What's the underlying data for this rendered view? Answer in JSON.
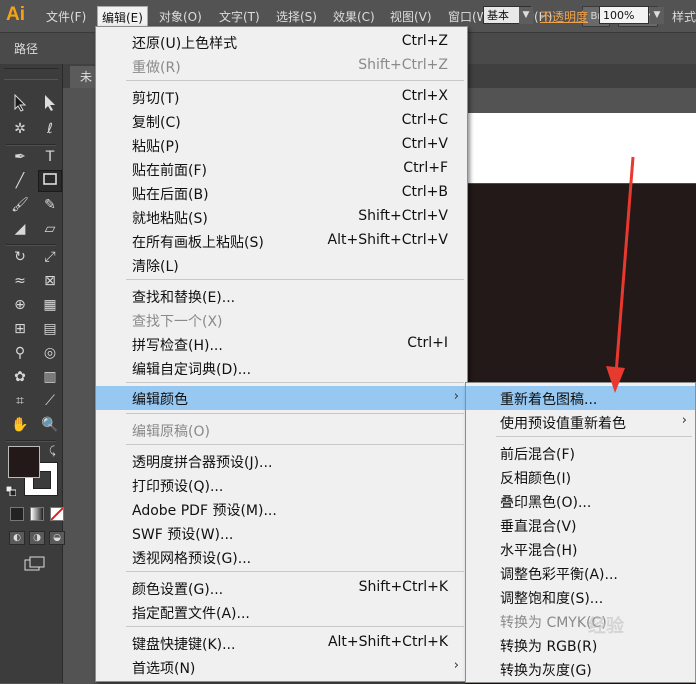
{
  "menubar": {
    "logo": "Ai",
    "items": [
      "文件(F)",
      "编辑(E)",
      "对象(O)",
      "文字(T)",
      "选择(S)",
      "效果(C)",
      "视图(V)",
      "窗口(W)",
      "帮助(H)"
    ],
    "br_label": "Br",
    "workspace_icon": "grid-layout-icon"
  },
  "control": {
    "path_label": "路径",
    "stroke_style": "基本",
    "opacity_label": "不透明度",
    "opacity_value": "100%",
    "style_label": "样式"
  },
  "doc": {
    "tab_label": "未"
  },
  "edit_menu": {
    "items": [
      {
        "label": "还原(U)上色样式",
        "shortcut": "Ctrl+Z"
      },
      {
        "label": "重做(R)",
        "shortcut": "Shift+Ctrl+Z",
        "disabled": true
      },
      {
        "label": "剪切(T)",
        "shortcut": "Ctrl+X"
      },
      {
        "label": "复制(C)",
        "shortcut": "Ctrl+C"
      },
      {
        "label": "粘贴(P)",
        "shortcut": "Ctrl+V"
      },
      {
        "label": "贴在前面(F)",
        "shortcut": "Ctrl+F"
      },
      {
        "label": "贴在后面(B)",
        "shortcut": "Ctrl+B"
      },
      {
        "label": "就地粘贴(S)",
        "shortcut": "Shift+Ctrl+V"
      },
      {
        "label": "在所有画板上粘贴(S)",
        "shortcut": "Alt+Shift+Ctrl+V"
      },
      {
        "label": "清除(L)",
        "shortcut": ""
      },
      {
        "label": "查找和替换(E)...",
        "shortcut": ""
      },
      {
        "label": "查找下一个(X)",
        "shortcut": "",
        "disabled": true
      },
      {
        "label": "拼写检查(H)...",
        "shortcut": "Ctrl+I"
      },
      {
        "label": "编辑自定词典(D)...",
        "shortcut": ""
      },
      {
        "label": "编辑颜色",
        "shortcut": "",
        "submenu": true,
        "highlighted": true
      },
      {
        "label": "编辑原稿(O)",
        "shortcut": "",
        "disabled": true
      },
      {
        "label": "透明度拼合器预设(J)...",
        "shortcut": ""
      },
      {
        "label": "打印预设(Q)...",
        "shortcut": ""
      },
      {
        "label": "Adobe PDF 预设(M)...",
        "shortcut": ""
      },
      {
        "label": "SWF 预设(W)...",
        "shortcut": ""
      },
      {
        "label": "透视网格预设(G)...",
        "shortcut": ""
      },
      {
        "label": "颜色设置(G)...",
        "shortcut": "Shift+Ctrl+K"
      },
      {
        "label": "指定配置文件(A)...",
        "shortcut": ""
      },
      {
        "label": "键盘快捷键(K)...",
        "shortcut": "Alt+Shift+Ctrl+K"
      },
      {
        "label": "首选项(N)",
        "shortcut": "",
        "submenu": true
      }
    ]
  },
  "color_submenu": {
    "items": [
      {
        "label": "重新着色图稿...",
        "highlighted": true
      },
      {
        "label": "使用预设值重新着色",
        "submenu": true
      },
      {
        "label": "前后混合(F)"
      },
      {
        "label": "反相颜色(I)"
      },
      {
        "label": "叠印黑色(O)..."
      },
      {
        "label": "垂直混合(V)"
      },
      {
        "label": "水平混合(H)"
      },
      {
        "label": "调整色彩平衡(A)..."
      },
      {
        "label": "调整饱和度(S)..."
      },
      {
        "label": "转换为 CMYK(C)"
      },
      {
        "label": "转换为 RGB(R)"
      },
      {
        "label": "转换为灰度(G)"
      }
    ]
  },
  "watermark": "经验",
  "colors": {
    "highlight": "#96c8f2",
    "arrow": "#e8392f",
    "artboard_dark": "#231918",
    "logo": "#f5a316"
  }
}
